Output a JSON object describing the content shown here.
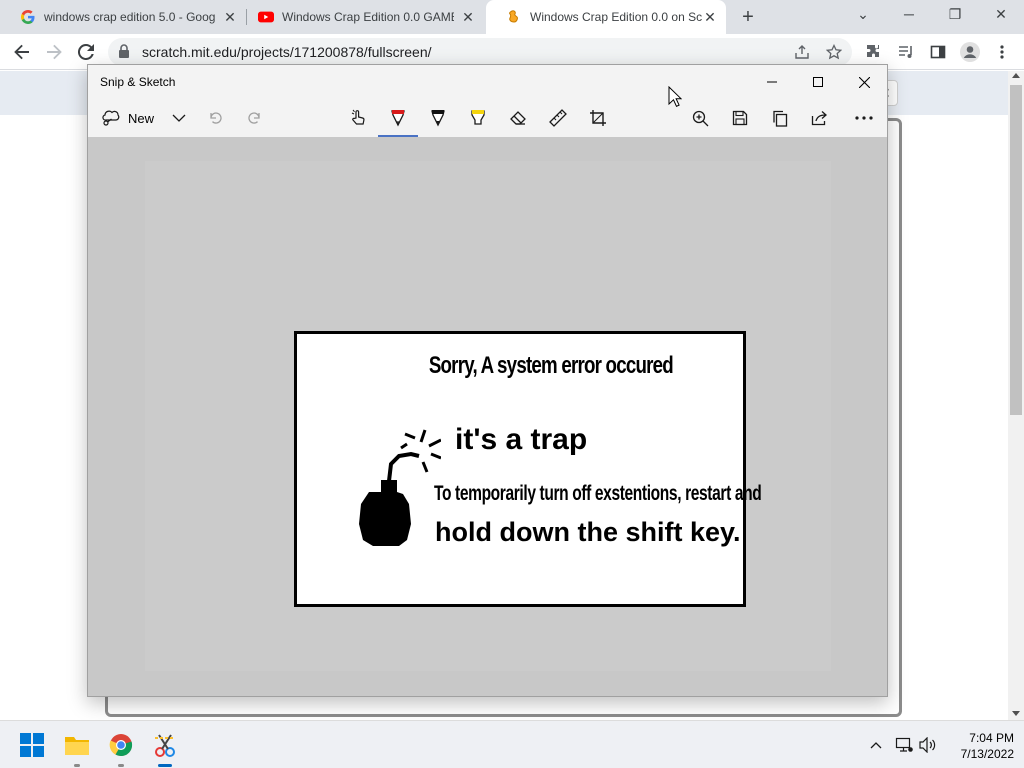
{
  "browser": {
    "tabs": [
      {
        "title": "windows crap edition 5.0 - Goog",
        "icon": "google-icon",
        "active": false
      },
      {
        "title": "Windows Crap Edition 0.0 GAME",
        "icon": "youtube-icon",
        "active": false
      },
      {
        "title": "Windows Crap Edition 0.0 on Scr",
        "icon": "scratch-icon",
        "active": true
      }
    ],
    "url": "scratch.mit.edu/projects/171200878/fullscreen/",
    "colors": {
      "tabstrip": "#dee1e6",
      "youtube_red": "#ff0000",
      "scratch_orange": "#f9a825"
    }
  },
  "snip": {
    "title": "Snip & Sketch",
    "new_label": "New",
    "tools": [
      "touch-writing-icon",
      "ballpoint-pen-icon",
      "pencil-icon",
      "highlighter-icon",
      "eraser-icon",
      "ruler-icon",
      "crop-icon"
    ],
    "actions": [
      "zoom-icon",
      "save-icon",
      "copy-icon",
      "share-icon",
      "more-icon"
    ]
  },
  "error_image": {
    "title": "Sorry, A system error occured",
    "headline": "it's a trap",
    "line1": "To temporarily turn off exstentions, restart and",
    "line2": "hold down the shift key."
  },
  "taskbar": {
    "time": "7:04 PM",
    "date": "7/13/2022",
    "apps": [
      "start-icon",
      "file-explorer-icon",
      "chrome-icon",
      "snip-sketch-icon"
    ]
  }
}
